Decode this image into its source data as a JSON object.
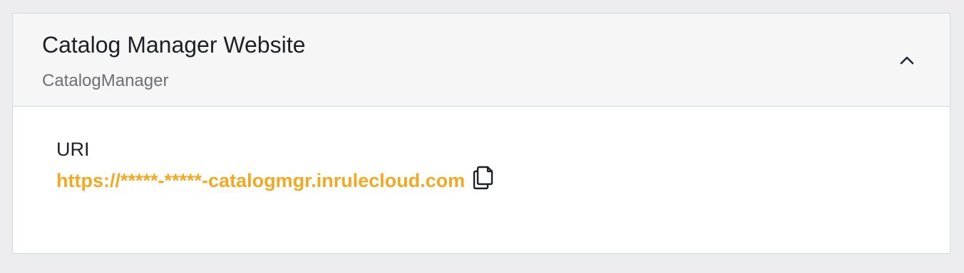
{
  "card": {
    "title": "Catalog Manager Website",
    "subtitle": "CatalogManager",
    "expanded": true,
    "toggle_icon": "chevron-up-icon"
  },
  "fields": {
    "uri_label": "URI",
    "uri_value": "https://*****-*****-catalogmgr.inrulecloud.com",
    "copy_icon": "copy-icon"
  },
  "colors": {
    "background": "#ededf0",
    "header_background": "#f6f6f7",
    "border": "#cfdbe0",
    "link": "#f2a922",
    "title_text": "#1f2025",
    "subtitle_text": "#6d6f73"
  }
}
